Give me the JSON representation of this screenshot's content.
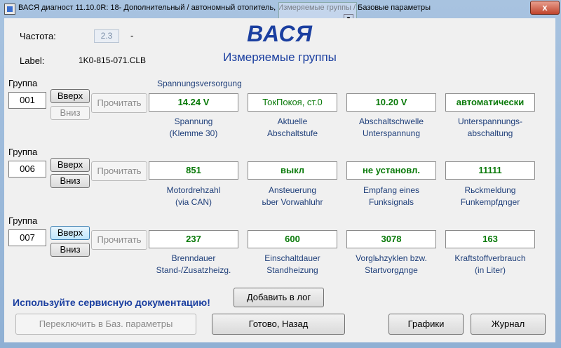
{
  "window": {
    "title": "ВАСЯ диагност 11.10.0R: 18- Дополнительный / автономный отопитель,  Измеряемые группы / Базовые параметры",
    "close_label": "x",
    "ghost_icon": "▼"
  },
  "header": {
    "freq_label": "Частота:",
    "freq_value": "2.3",
    "freq_dash": "-",
    "label_label": "Label:",
    "label_value": "1K0-815-071.CLB",
    "brand": "ВАСЯ",
    "subtitle": "Измеряемые группы"
  },
  "groups": [
    {
      "group_label": "Группа",
      "number": "001",
      "up_label": "Вверх",
      "down_label": "Вниз",
      "read_label": "Прочитать",
      "heading": "Spannungsversorgung",
      "fields": [
        {
          "value": "14.24 V",
          "caption1": "Spannung",
          "caption2": "(Klemme 30)"
        },
        {
          "value": "ТокПокоя, ст.0",
          "caption1": "Aktuelle",
          "caption2": "Abschaltstufe"
        },
        {
          "value": "10.20 V",
          "caption1": "Abschaltschwelle",
          "caption2": "Unterspannung"
        },
        {
          "value": "автоматически",
          "caption1": "Unterspannungs-",
          "caption2": "abschaltung"
        }
      ]
    },
    {
      "group_label": "Группа",
      "number": "006",
      "up_label": "Вверх",
      "down_label": "Вниз",
      "read_label": "Прочитать",
      "heading": "",
      "fields": [
        {
          "value": "851",
          "caption1": "Motordrehzahl",
          "caption2": "(via CAN)"
        },
        {
          "value": "выкл",
          "caption1": "Ansteuerung",
          "caption2": "ьber Vorwahluhr"
        },
        {
          "value": "не установл.",
          "caption1": "Empfang eines",
          "caption2": "Funksignals"
        },
        {
          "value": "11111",
          "caption1": "Rьckmeldung",
          "caption2": "Funkempfдnger"
        }
      ]
    },
    {
      "group_label": "Группа",
      "number": "007",
      "up_label": "Вверх",
      "down_label": "Вниз",
      "read_label": "Прочитать",
      "heading": "",
      "fields": [
        {
          "value": "237",
          "caption1": "Brenndauer",
          "caption2": "Stand-/Zusatzheizg."
        },
        {
          "value": "600",
          "caption1": "Einschaltdauer",
          "caption2": "Standheizung"
        },
        {
          "value": "3078",
          "caption1": "Vorglьhzyklen bzw.",
          "caption2": "Startvorgдnge"
        },
        {
          "value": "163",
          "caption1": "Kraftstoffverbrauch",
          "caption2": "(in Liter)"
        }
      ]
    }
  ],
  "footer": {
    "hint": "Используйте сервисную документацию!",
    "add_log": "Добавить в лог",
    "switch_basic": "Переключить в Баз. параметры",
    "done_back": "Готово, Назад",
    "graphs": "Графики",
    "journal": "Журнал"
  }
}
